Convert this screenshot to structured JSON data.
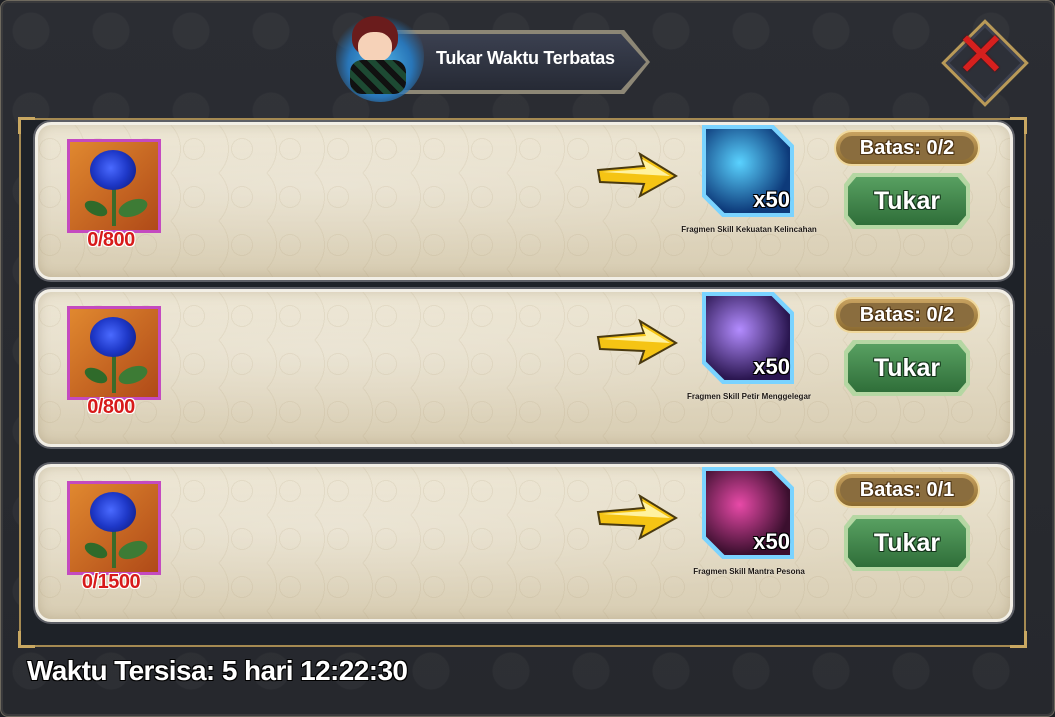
{
  "header": {
    "title": "Tukar Waktu Terbatas"
  },
  "close": {
    "icon": "close-x-icon",
    "color": "#d6201e"
  },
  "rows": [
    {
      "cost_item": "blue-rose-icon",
      "cost_count": "0/800",
      "reward_name": "Fragmen Skill Kekuatan Kelincahan",
      "reward_qty": "x50",
      "reward_colors": [
        "#0d3a7a",
        "#5ad2ff"
      ],
      "limit": "Batas: 0/2",
      "button": "Tukar"
    },
    {
      "cost_item": "blue-rose-icon",
      "cost_count": "0/800",
      "reward_name": "Fragmen Skill Petir Menggelegar",
      "reward_qty": "x50",
      "reward_colors": [
        "#2a1650",
        "#b38cff"
      ],
      "limit": "Batas: 0/2",
      "button": "Tukar"
    },
    {
      "cost_item": "blue-rose-icon",
      "cost_count": "0/1500",
      "reward_name": "Fragmen Skill Mantra Pesona",
      "reward_qty": "x50",
      "reward_colors": [
        "#3b0f2e",
        "#e84aa8"
      ],
      "limit": "Batas: 0/1",
      "button": "Tukar"
    }
  ],
  "footer": {
    "timer": "Waktu Tersisa: 5 hari 12:22:30"
  }
}
